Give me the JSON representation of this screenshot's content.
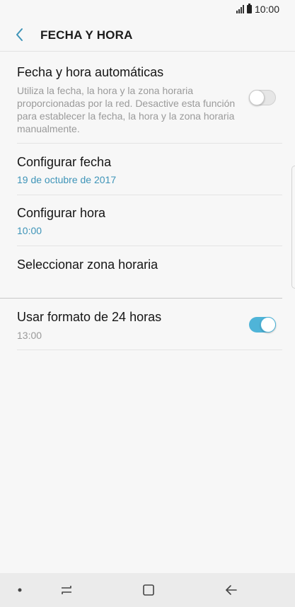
{
  "status_bar": {
    "time": "10:00"
  },
  "header": {
    "title": "FECHA Y HORA"
  },
  "settings": {
    "auto": {
      "title": "Fecha y hora automáticas",
      "description": "Utiliza la fecha, la hora y la zona horaria proporcionadas por la red. Desactive esta función para establecer la fecha, la hora y la zona horaria manualmente.",
      "enabled": false
    },
    "date": {
      "title": "Configurar fecha",
      "value": "19 de octubre de 2017"
    },
    "time": {
      "title": "Configurar hora",
      "value": "10:00"
    },
    "timezone": {
      "title": "Seleccionar zona horaria"
    },
    "format24": {
      "title": "Usar formato de 24 horas",
      "value": "13:00",
      "enabled": true
    }
  },
  "colors": {
    "accent": "#4fb4d8",
    "link_text": "#3e94b8"
  },
  "icons": {
    "back": "back-arrow-icon",
    "signal": "signal-icon",
    "battery": "battery-icon",
    "nav_dot": "dot-icon",
    "nav_recents": "recents-icon",
    "nav_home": "home-icon",
    "nav_back": "back-icon"
  }
}
